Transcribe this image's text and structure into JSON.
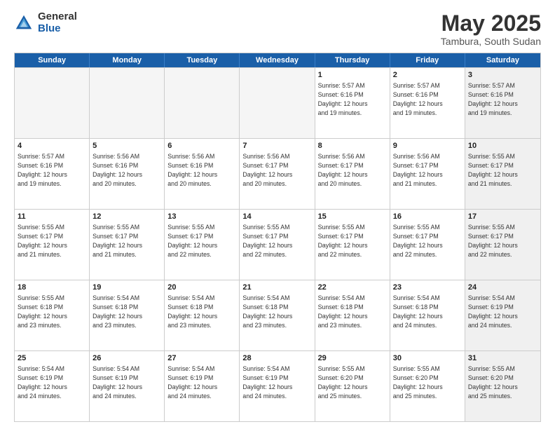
{
  "logo": {
    "general": "General",
    "blue": "Blue"
  },
  "title": "May 2025",
  "location": "Tambura, South Sudan",
  "days": [
    "Sunday",
    "Monday",
    "Tuesday",
    "Wednesday",
    "Thursday",
    "Friday",
    "Saturday"
  ],
  "rows": [
    [
      {
        "day": "",
        "text": "",
        "empty": true
      },
      {
        "day": "",
        "text": "",
        "empty": true
      },
      {
        "day": "",
        "text": "",
        "empty": true
      },
      {
        "day": "",
        "text": "",
        "empty": true
      },
      {
        "day": "1",
        "text": "Sunrise: 5:57 AM\nSunset: 6:16 PM\nDaylight: 12 hours\nand 19 minutes.",
        "empty": false
      },
      {
        "day": "2",
        "text": "Sunrise: 5:57 AM\nSunset: 6:16 PM\nDaylight: 12 hours\nand 19 minutes.",
        "empty": false
      },
      {
        "day": "3",
        "text": "Sunrise: 5:57 AM\nSunset: 6:16 PM\nDaylight: 12 hours\nand 19 minutes.",
        "empty": false,
        "shaded": true
      }
    ],
    [
      {
        "day": "4",
        "text": "Sunrise: 5:57 AM\nSunset: 6:16 PM\nDaylight: 12 hours\nand 19 minutes.",
        "empty": false
      },
      {
        "day": "5",
        "text": "Sunrise: 5:56 AM\nSunset: 6:16 PM\nDaylight: 12 hours\nand 20 minutes.",
        "empty": false
      },
      {
        "day": "6",
        "text": "Sunrise: 5:56 AM\nSunset: 6:16 PM\nDaylight: 12 hours\nand 20 minutes.",
        "empty": false
      },
      {
        "day": "7",
        "text": "Sunrise: 5:56 AM\nSunset: 6:17 PM\nDaylight: 12 hours\nand 20 minutes.",
        "empty": false
      },
      {
        "day": "8",
        "text": "Sunrise: 5:56 AM\nSunset: 6:17 PM\nDaylight: 12 hours\nand 20 minutes.",
        "empty": false
      },
      {
        "day": "9",
        "text": "Sunrise: 5:56 AM\nSunset: 6:17 PM\nDaylight: 12 hours\nand 21 minutes.",
        "empty": false
      },
      {
        "day": "10",
        "text": "Sunrise: 5:55 AM\nSunset: 6:17 PM\nDaylight: 12 hours\nand 21 minutes.",
        "empty": false,
        "shaded": true
      }
    ],
    [
      {
        "day": "11",
        "text": "Sunrise: 5:55 AM\nSunset: 6:17 PM\nDaylight: 12 hours\nand 21 minutes.",
        "empty": false
      },
      {
        "day": "12",
        "text": "Sunrise: 5:55 AM\nSunset: 6:17 PM\nDaylight: 12 hours\nand 21 minutes.",
        "empty": false
      },
      {
        "day": "13",
        "text": "Sunrise: 5:55 AM\nSunset: 6:17 PM\nDaylight: 12 hours\nand 22 minutes.",
        "empty": false
      },
      {
        "day": "14",
        "text": "Sunrise: 5:55 AM\nSunset: 6:17 PM\nDaylight: 12 hours\nand 22 minutes.",
        "empty": false
      },
      {
        "day": "15",
        "text": "Sunrise: 5:55 AM\nSunset: 6:17 PM\nDaylight: 12 hours\nand 22 minutes.",
        "empty": false
      },
      {
        "day": "16",
        "text": "Sunrise: 5:55 AM\nSunset: 6:17 PM\nDaylight: 12 hours\nand 22 minutes.",
        "empty": false
      },
      {
        "day": "17",
        "text": "Sunrise: 5:55 AM\nSunset: 6:17 PM\nDaylight: 12 hours\nand 22 minutes.",
        "empty": false,
        "shaded": true
      }
    ],
    [
      {
        "day": "18",
        "text": "Sunrise: 5:55 AM\nSunset: 6:18 PM\nDaylight: 12 hours\nand 23 minutes.",
        "empty": false
      },
      {
        "day": "19",
        "text": "Sunrise: 5:54 AM\nSunset: 6:18 PM\nDaylight: 12 hours\nand 23 minutes.",
        "empty": false
      },
      {
        "day": "20",
        "text": "Sunrise: 5:54 AM\nSunset: 6:18 PM\nDaylight: 12 hours\nand 23 minutes.",
        "empty": false
      },
      {
        "day": "21",
        "text": "Sunrise: 5:54 AM\nSunset: 6:18 PM\nDaylight: 12 hours\nand 23 minutes.",
        "empty": false
      },
      {
        "day": "22",
        "text": "Sunrise: 5:54 AM\nSunset: 6:18 PM\nDaylight: 12 hours\nand 23 minutes.",
        "empty": false
      },
      {
        "day": "23",
        "text": "Sunrise: 5:54 AM\nSunset: 6:18 PM\nDaylight: 12 hours\nand 24 minutes.",
        "empty": false
      },
      {
        "day": "24",
        "text": "Sunrise: 5:54 AM\nSunset: 6:19 PM\nDaylight: 12 hours\nand 24 minutes.",
        "empty": false,
        "shaded": true
      }
    ],
    [
      {
        "day": "25",
        "text": "Sunrise: 5:54 AM\nSunset: 6:19 PM\nDaylight: 12 hours\nand 24 minutes.",
        "empty": false
      },
      {
        "day": "26",
        "text": "Sunrise: 5:54 AM\nSunset: 6:19 PM\nDaylight: 12 hours\nand 24 minutes.",
        "empty": false
      },
      {
        "day": "27",
        "text": "Sunrise: 5:54 AM\nSunset: 6:19 PM\nDaylight: 12 hours\nand 24 minutes.",
        "empty": false
      },
      {
        "day": "28",
        "text": "Sunrise: 5:54 AM\nSunset: 6:19 PM\nDaylight: 12 hours\nand 24 minutes.",
        "empty": false
      },
      {
        "day": "29",
        "text": "Sunrise: 5:55 AM\nSunset: 6:20 PM\nDaylight: 12 hours\nand 25 minutes.",
        "empty": false
      },
      {
        "day": "30",
        "text": "Sunrise: 5:55 AM\nSunset: 6:20 PM\nDaylight: 12 hours\nand 25 minutes.",
        "empty": false
      },
      {
        "day": "31",
        "text": "Sunrise: 5:55 AM\nSunset: 6:20 PM\nDaylight: 12 hours\nand 25 minutes.",
        "empty": false,
        "shaded": true
      }
    ]
  ]
}
